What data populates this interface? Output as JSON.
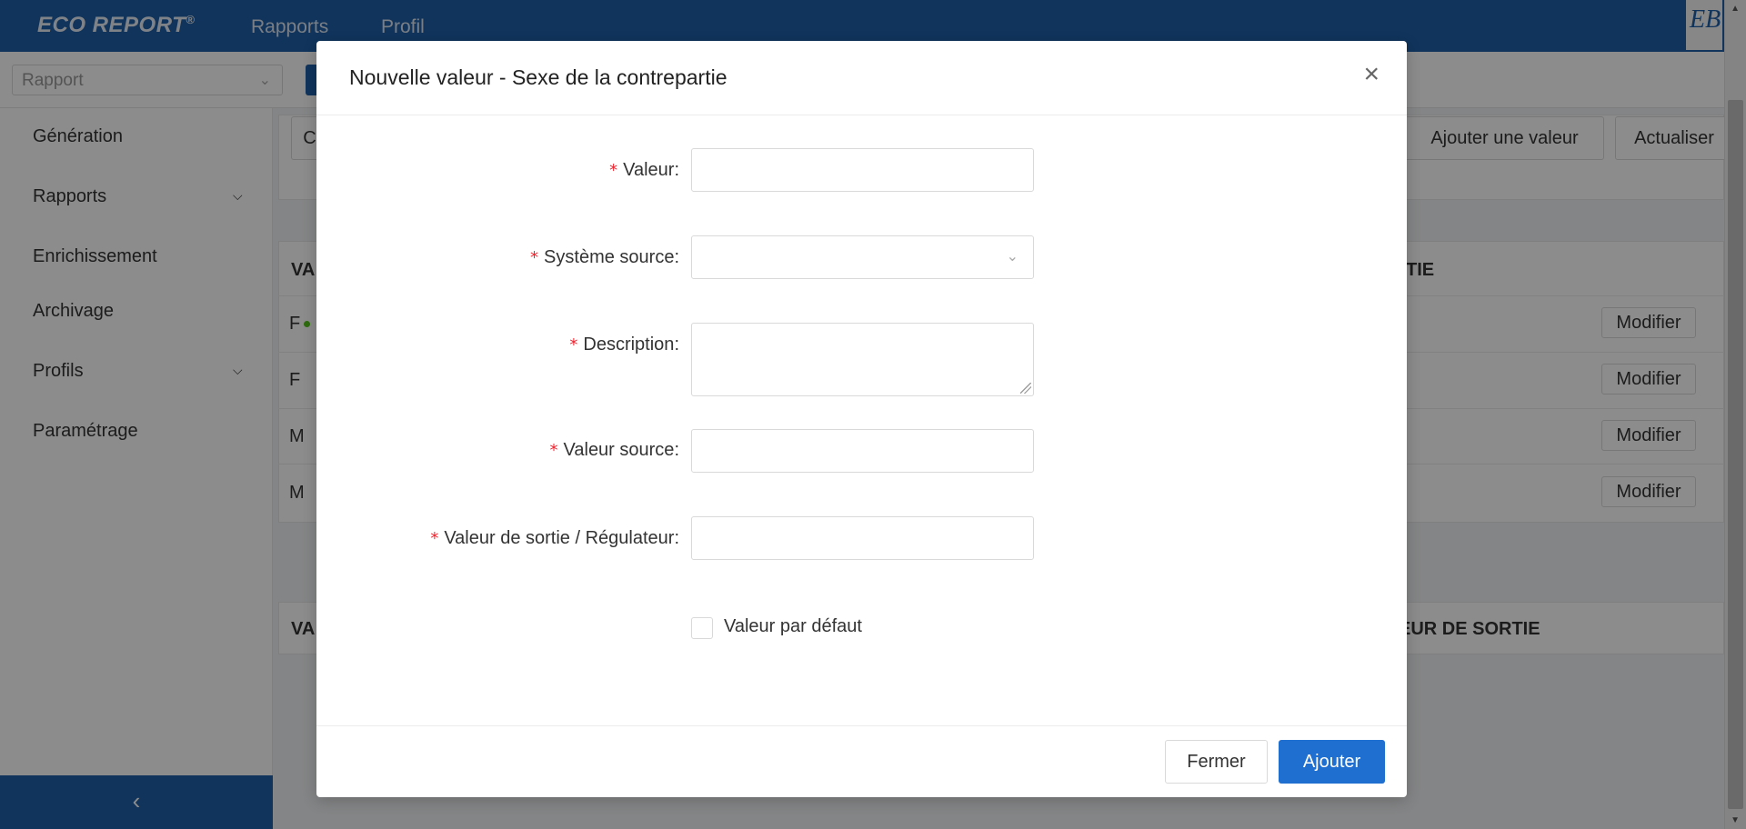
{
  "header": {
    "brand": "ECO REPORT",
    "brand_mark": "®",
    "nav": [
      "Rapports",
      "Profil"
    ],
    "logo_text": "EB"
  },
  "toolbar": {
    "report_select_placeholder": "Rapport"
  },
  "sidebar": {
    "items": [
      {
        "label": "Génération",
        "has_children": false
      },
      {
        "label": "Rapports",
        "has_children": true
      },
      {
        "label": "Enrichissement",
        "has_children": false
      },
      {
        "label": "Archivage",
        "has_children": false
      },
      {
        "label": "Profils",
        "has_children": true
      },
      {
        "label": "Paramétrage",
        "has_children": false
      }
    ],
    "collapse_icon": "‹"
  },
  "background": {
    "partial_tab": "C",
    "buttons": {
      "add_value": "Ajouter une valeur",
      "refresh": "Actualiser"
    },
    "table1": {
      "header_left": "VA",
      "header_right": "TIE",
      "rows": [
        {
          "value": "F",
          "default": true,
          "action": "Modifier"
        },
        {
          "value": "F",
          "default": false,
          "action": "Modifier"
        },
        {
          "value": "M",
          "default": false,
          "action": "Modifier"
        },
        {
          "value": "M",
          "default": false,
          "action": "Modifier"
        }
      ]
    },
    "table2": {
      "header_left": "VA",
      "header_right": "EUR DE SORTIE"
    }
  },
  "modal": {
    "title": "Nouvelle valeur - Sexe de la contrepartie",
    "close_icon": "×",
    "fields": {
      "valeur": {
        "label": "Valeur",
        "value": "",
        "required": true
      },
      "systeme_source": {
        "label": "Système source",
        "value": "",
        "required": true
      },
      "description": {
        "label": "Description",
        "value": "",
        "required": true
      },
      "valeur_source": {
        "label": "Valeur source",
        "value": "",
        "required": true
      },
      "valeur_sortie": {
        "label": "Valeur de sortie / Régulateur",
        "value": "",
        "required": true
      }
    },
    "label_suffix": ":",
    "required_mark": "*",
    "checkbox": {
      "label": "Valeur par défaut",
      "checked": false
    },
    "buttons": {
      "close": "Fermer",
      "submit": "Ajouter"
    }
  }
}
